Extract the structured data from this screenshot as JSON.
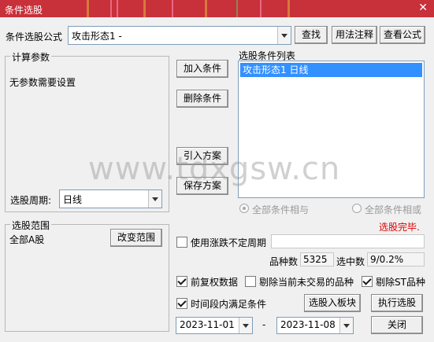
{
  "window": {
    "title": "条件选股",
    "close_glyph": "✕"
  },
  "formula": {
    "label": "条件选股公式",
    "value": "攻击形态1     -",
    "buttons": {
      "find": "查找",
      "usage": "用法注释",
      "view": "查看公式"
    }
  },
  "params": {
    "legend": "计算参数",
    "message": "无参数需要设置"
  },
  "period": {
    "label": "选股周期:",
    "value": "日线"
  },
  "actions": {
    "add": "加入条件",
    "delete": "删除条件",
    "import": "引入方案",
    "save": "保存方案"
  },
  "condition_list": {
    "label": "选股条件列表",
    "items": [
      "攻击形态1  日线"
    ]
  },
  "logic": {
    "and_label": "全部条件相与",
    "or_label": "全部条件相或",
    "selected": "and"
  },
  "status": {
    "text": "选股完毕.",
    "color": "#e00000"
  },
  "range": {
    "legend": "选股范围",
    "value": "全部A股",
    "change_button": "改变范围"
  },
  "options": {
    "variable_period": {
      "label": "使用涨跌不定周期",
      "checked": false,
      "value": ""
    },
    "adjusted": {
      "label": "前复权数据",
      "checked": true
    },
    "exclude_untraded": {
      "label": "剔除当前未交易的品种",
      "checked": false
    },
    "exclude_st": {
      "label": "剔除ST品种",
      "checked": true
    },
    "time_range": {
      "label": "时间段内满足条件",
      "checked": true
    }
  },
  "stats": {
    "count_label": "品种数",
    "count_value": "5325",
    "selected_label": "选中数",
    "selected_value": "9/0.2%"
  },
  "bottom": {
    "to_block": "选股入板块",
    "execute": "执行选股",
    "close": "关闭"
  },
  "dates": {
    "start": "2023-11-01",
    "separator": "-",
    "end": "2023-11-08"
  },
  "watermark": "www.tdxgsw.cn"
}
